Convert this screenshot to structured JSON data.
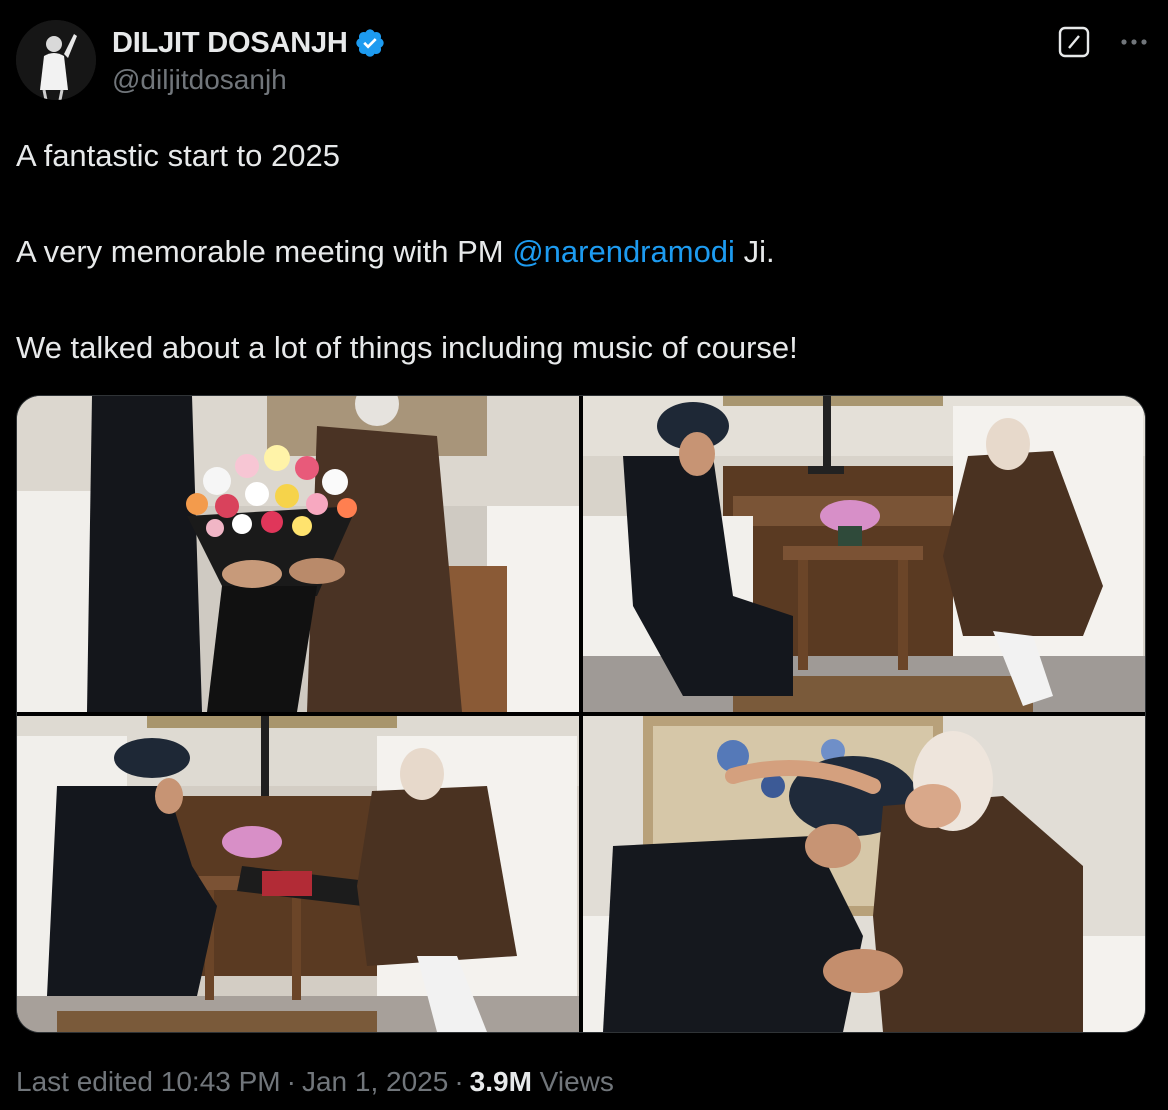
{
  "tweet": {
    "author": {
      "display_name": "DILJIT DOSANJH",
      "handle": "@diljitdosanjh",
      "verified": true,
      "avatar_icon": "avatar-photo"
    },
    "actions": {
      "grok_icon": "grok-icon",
      "more_icon": "more-icon"
    },
    "text": {
      "line1": "A fantastic start to 2025",
      "line2_prefix": "A very memorable meeting with PM ",
      "line2_mention": "@narendramodi",
      "line2_suffix": " Ji.",
      "line3": "We talked about a lot of things including music of course!"
    },
    "media": {
      "count": 4
    },
    "meta": {
      "edited_prefix": "Last edited",
      "time": "10:43 PM",
      "date": "Jan 1, 2025",
      "views_count": "3.9M",
      "views_label": "Views",
      "separator": "·"
    }
  },
  "colors": {
    "background": "#000000",
    "text_primary": "#e7e9ea",
    "text_secondary": "#71767b",
    "accent": "#1d9bf0",
    "border": "#2f3336"
  }
}
